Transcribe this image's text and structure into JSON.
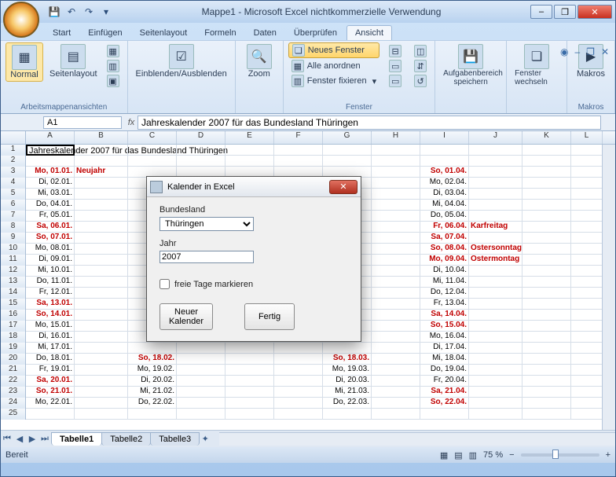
{
  "window": {
    "title": "Mappe1 - Microsoft Excel nichtkommerzielle Verwendung"
  },
  "tabs": {
    "start": "Start",
    "einfuegen": "Einfügen",
    "seitenlayout": "Seitenlayout",
    "formeln": "Formeln",
    "daten": "Daten",
    "ueberpruefen": "Überprüfen",
    "ansicht": "Ansicht"
  },
  "ribbon": {
    "g1_label": "Arbeitsmappenansichten",
    "normal": "Normal",
    "seitenlayout": "Seitenlayout",
    "ein_aus": "Einblenden/Ausblenden",
    "zoom": "Zoom",
    "neues_fenster": "Neues Fenster",
    "alle_anordnen": "Alle anordnen",
    "fenster_fixieren": "Fenster fixieren",
    "aufgabenbereich": "Aufgabenbereich speichern",
    "fenster_wechseln": "Fenster wechseln",
    "makros": "Makros",
    "fenster_label": "Fenster",
    "makros_label": "Makros"
  },
  "namebox": "A1",
  "formula": "Jahreskalender 2007 für das Bundesland Thüringen",
  "columns": [
    "A",
    "B",
    "C",
    "D",
    "E",
    "F",
    "G",
    "H",
    "I",
    "J",
    "K",
    "L"
  ],
  "a1_text": "Jahreskalender 2007 für das Bundesland Thüringen",
  "rows": [
    {
      "n": 3,
      "A": "Mo, 01.01.",
      "B": "Neujahr",
      "I": "So, 01.04.",
      "red": [
        "A",
        "B",
        "I"
      ]
    },
    {
      "n": 4,
      "A": "Di, 02.01.",
      "I": "Mo, 02.04."
    },
    {
      "n": 5,
      "A": "Mi, 03.01.",
      "I": "Di, 03.04."
    },
    {
      "n": 6,
      "A": "Do, 04.01.",
      "I": "Mi, 04.04."
    },
    {
      "n": 7,
      "A": "Fr, 05.01.",
      "I": "Do, 05.04."
    },
    {
      "n": 8,
      "A": "Sa, 06.01.",
      "I": "Fr, 06.04.",
      "J": "Karfreitag",
      "red": [
        "A",
        "I",
        "J"
      ]
    },
    {
      "n": 9,
      "A": "So, 07.01.",
      "I": "Sa, 07.04.",
      "red": [
        "A",
        "I"
      ]
    },
    {
      "n": 10,
      "A": "Mo, 08.01.",
      "I": "So, 08.04.",
      "J": "Ostersonntag",
      "red": [
        "I",
        "J"
      ]
    },
    {
      "n": 11,
      "A": "Di, 09.01.",
      "I": "Mo, 09.04.",
      "J": "Ostermontag",
      "red": [
        "I",
        "J"
      ]
    },
    {
      "n": 12,
      "A": "Mi, 10.01.",
      "I": "Di, 10.04."
    },
    {
      "n": 13,
      "A": "Do, 11.01.",
      "I": "Mi, 11.04."
    },
    {
      "n": 14,
      "A": "Fr, 12.01.",
      "I": "Do, 12.04."
    },
    {
      "n": 15,
      "A": "Sa, 13.01.",
      "I": "Fr, 13.04.",
      "red": [
        "A"
      ]
    },
    {
      "n": 16,
      "A": "So, 14.01.",
      "I": "Sa, 14.04.",
      "red": [
        "A",
        "I"
      ]
    },
    {
      "n": 17,
      "A": "Mo, 15.01.",
      "I": "So, 15.04.",
      "red": [
        "I"
      ]
    },
    {
      "n": 18,
      "A": "Di, 16.01.",
      "I": "Mo, 16.04."
    },
    {
      "n": 19,
      "A": "Mi, 17.01.",
      "I": "Di, 17.04."
    },
    {
      "n": 20,
      "A": "Do, 18.01.",
      "C": "So, 18.02.",
      "G": "So, 18.03.",
      "I": "Mi, 18.04.",
      "red": [
        "C",
        "G"
      ]
    },
    {
      "n": 21,
      "A": "Fr, 19.01.",
      "C": "Mo, 19.02.",
      "G": "Mo, 19.03.",
      "I": "Do, 19.04."
    },
    {
      "n": 22,
      "A": "Sa, 20.01.",
      "C": "Di, 20.02.",
      "G": "Di, 20.03.",
      "I": "Fr, 20.04.",
      "red": [
        "A"
      ]
    },
    {
      "n": 23,
      "A": "So, 21.01.",
      "C": "Mi, 21.02.",
      "G": "Mi, 21.03.",
      "I": "Sa, 21.04.",
      "red": [
        "A",
        "I"
      ]
    },
    {
      "n": 24,
      "A": "Mo, 22.01.",
      "C": "Do, 22.02.",
      "G": "Do, 22.03.",
      "I": "So, 22.04.",
      "red": [
        "I"
      ]
    }
  ],
  "sheets": {
    "s1": "Tabelle1",
    "s2": "Tabelle2",
    "s3": "Tabelle3"
  },
  "status": {
    "ready": "Bereit",
    "zoom": "75 %"
  },
  "dialog": {
    "title": "Kalender in Excel",
    "bundesland_label": "Bundesland",
    "bundesland_value": "Thüringen",
    "jahr_label": "Jahr",
    "jahr_value": "2007",
    "checkbox": "freie Tage markieren",
    "btn_neu": "Neuer Kalender",
    "btn_fertig": "Fertig"
  }
}
